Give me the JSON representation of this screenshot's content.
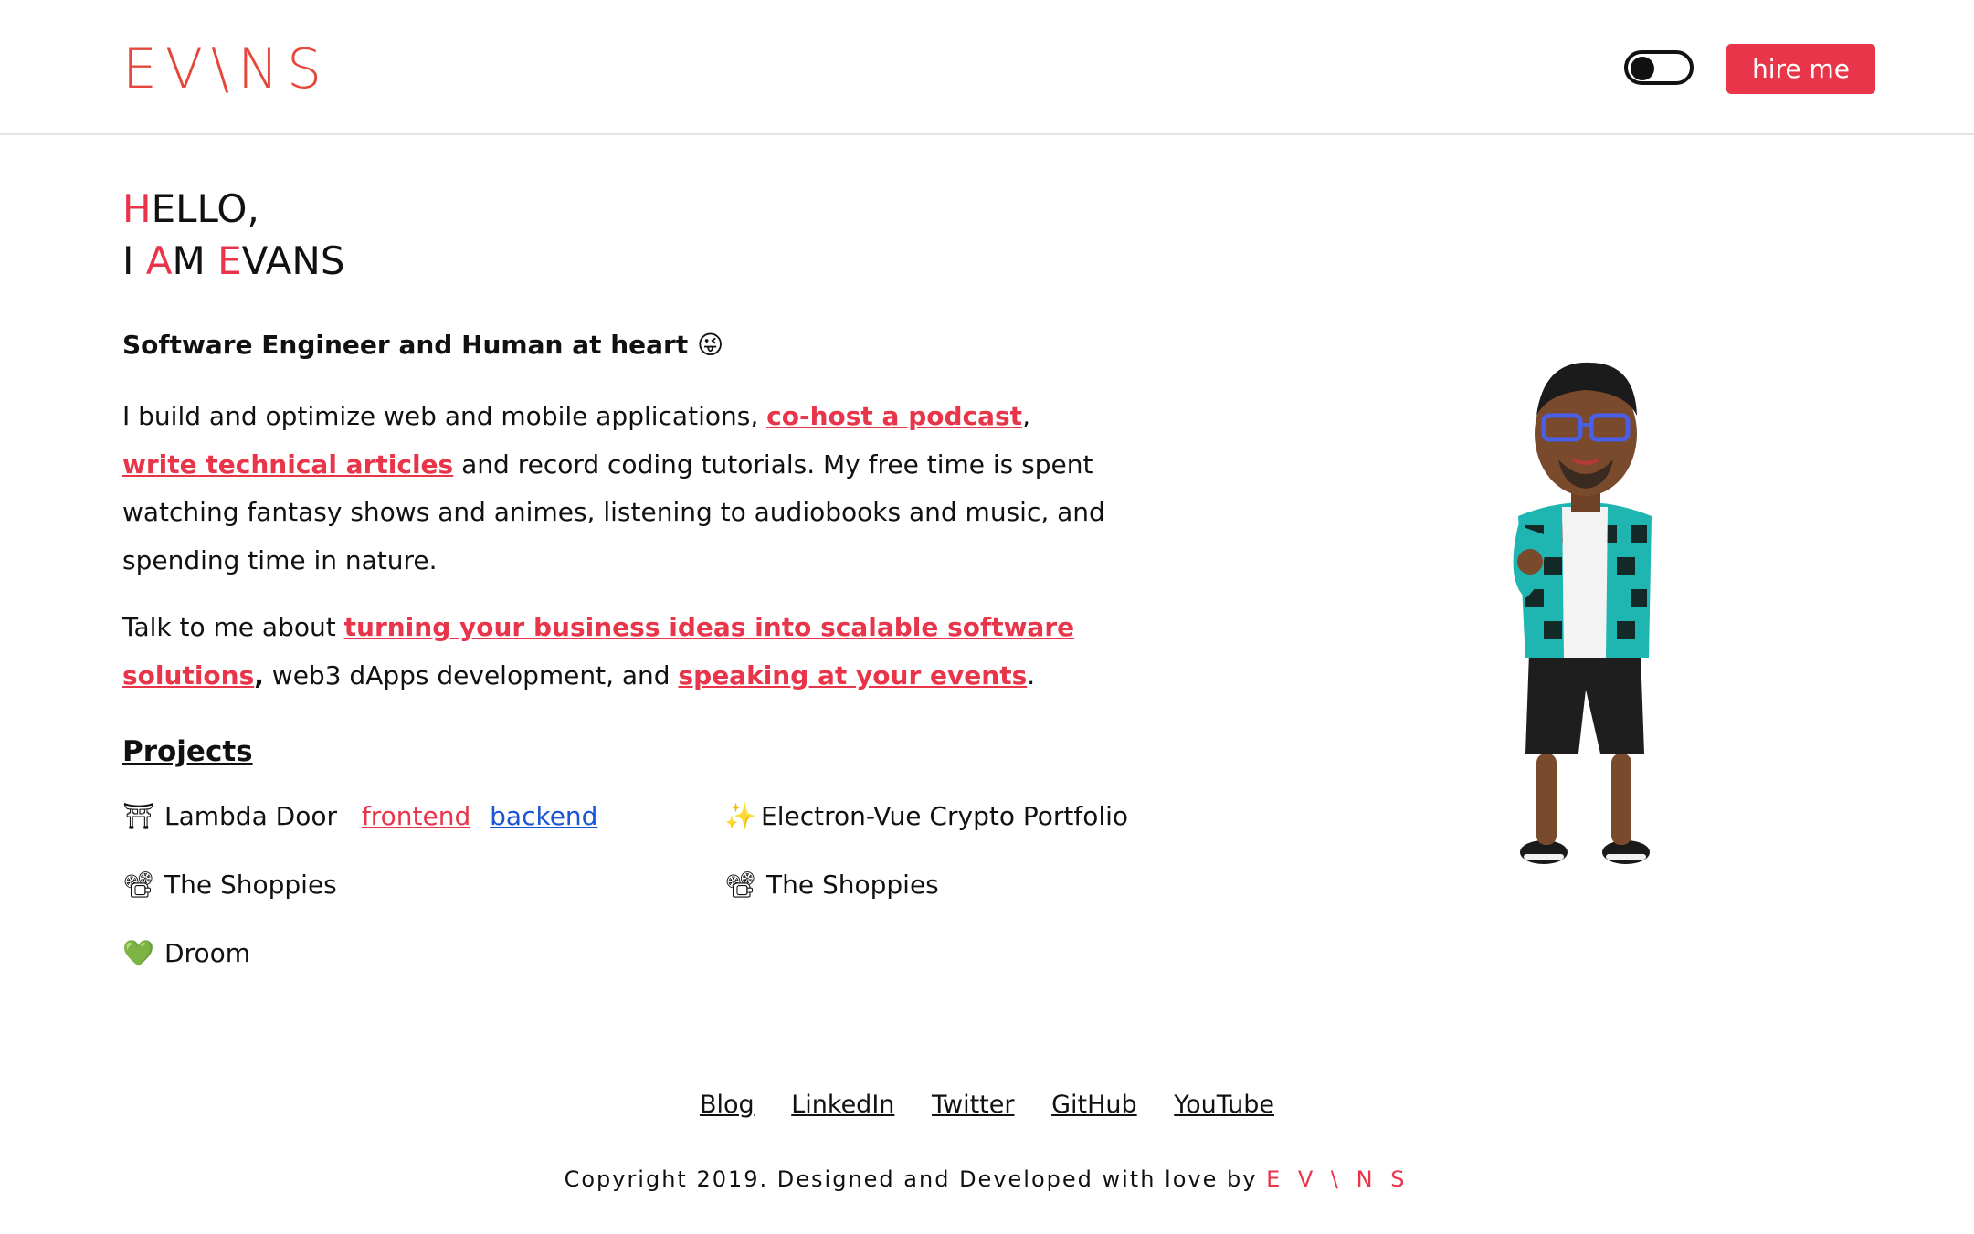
{
  "header": {
    "logo": "EV\\NS",
    "hire_label": "hire me",
    "accent_color": "#e8354a",
    "logo_color": "#e5483b",
    "theme_toggle": "dark-mode-toggle"
  },
  "hero": {
    "line1_initial": "H",
    "line1_rest": "ELLO,",
    "line2_w1": "I",
    "line2_w2_initial": "A",
    "line2_w2_rest": "M",
    "line2_w3_initial": "E",
    "line2_w3_rest": "VANS",
    "subtitle": "Software Engineer and Human at heart",
    "subtitle_emoji": "😜"
  },
  "bio": {
    "t1": "I build and optimize web and mobile applications, ",
    "l1": "co-host a podcast",
    "t2": ", ",
    "l2": "write technical articles",
    "t3": " and record coding tutorials. My free time is spent watching fantasy shows and animes, listening to audiobooks and music, and spending time in nature."
  },
  "talk": {
    "t1": "Talk to me about ",
    "l1": "turning your business ideas into scalable software solutions",
    "t2": ",",
    "t3": " web3 dApps development, and ",
    "l2": "speaking at your events",
    "t4": "."
  },
  "projects": {
    "title": "Projects",
    "items": [
      {
        "emoji": "⛩",
        "name": "Lambda Door",
        "link1": "frontend",
        "link2": "backend"
      },
      {
        "emoji": "✨",
        "name": "Electron-Vue Crypto Portfolio"
      },
      {
        "emoji": "📽",
        "name": "The Shoppies"
      },
      {
        "emoji": "📽",
        "name": "The Shoppies"
      },
      {
        "emoji": "💚",
        "name": "Droom"
      }
    ]
  },
  "footer": {
    "links": [
      "Blog",
      "LinkedIn",
      "Twitter",
      "GitHub",
      "YouTube"
    ],
    "copyright": "Copyright 2019. Designed and Developed with love by ",
    "brand": "E V \\ N S"
  }
}
